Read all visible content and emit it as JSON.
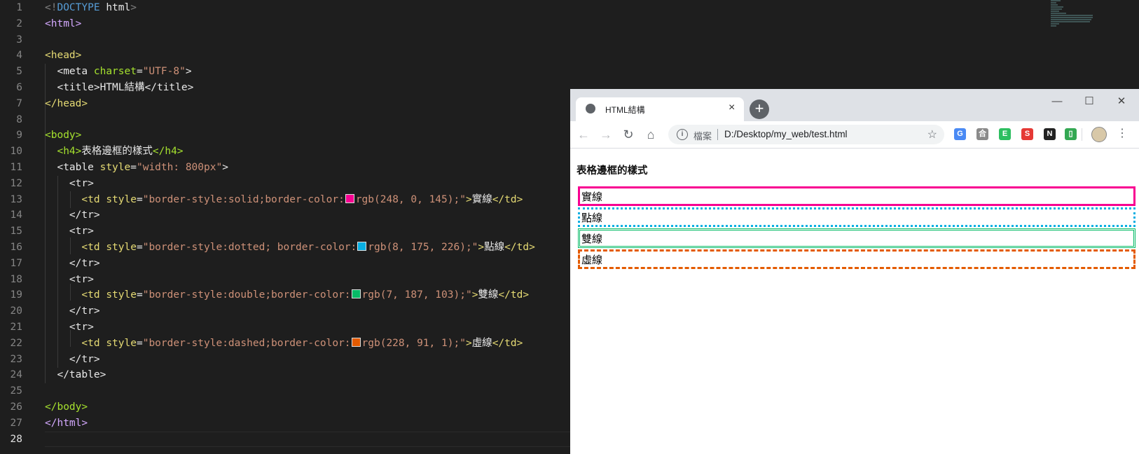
{
  "editor": {
    "line_numbers": [
      "1",
      "2",
      "3",
      "4",
      "5",
      "6",
      "7",
      "8",
      "9",
      "10",
      "11",
      "12",
      "13",
      "14",
      "15",
      "16",
      "17",
      "18",
      "19",
      "20",
      "21",
      "22",
      "23",
      "24",
      "25",
      "26",
      "27",
      "28"
    ],
    "doctype_open": "<!",
    "doctype_kw": "DOCTYPE",
    "doctype_html": "html",
    "doctype_close": ">",
    "html_open": "<html>",
    "head_open": "<head>",
    "meta_tag": "<meta",
    "meta_attr": "charset",
    "meta_eq": "=",
    "meta_val": "\"UTF-8\"",
    "meta_close": ">",
    "title_open": "<title>",
    "title_text": "HTML結構",
    "title_close": "</title>",
    "head_close": "</head>",
    "body_open": "<body>",
    "h4_open": "<h4>",
    "h4_text": "表格邊框的樣式",
    "h4_close": "</h4>",
    "table_open": "<table",
    "table_attr": "style",
    "table_eq": "=",
    "table_val": "\"width: 800px\"",
    "table_gt": ">",
    "tr_open": "<tr>",
    "tr_close": "</tr>",
    "td_open": "<td",
    "td_attr": "style",
    "td_eq": "=",
    "td_close": "</td>",
    "rows": [
      {
        "pre": "\"border-style:solid;border-color:",
        "color": "rgb(248, 0, 145)",
        "post": ";\"",
        "text": "實線",
        "swatch": "#f80091"
      },
      {
        "pre": "\"border-style:dotted; border-color:",
        "color": "rgb(8, 175, 226)",
        "post": ";\"",
        "text": "點線",
        "swatch": "#08afe2"
      },
      {
        "pre": "\"border-style:double;border-color:",
        "color": "rgb(7, 187, 103)",
        "post": ";\"",
        "text": "雙線",
        "swatch": "#07bb67"
      },
      {
        "pre": "\"border-style:dashed;border-color:",
        "color": "rgb(228, 91, 1)",
        "post": ";\"",
        "text": "虛線",
        "swatch": "#e45b01"
      }
    ],
    "gt": ">",
    "table_close": "</table>",
    "body_close": "</body>",
    "html_close": "</html>"
  },
  "browser": {
    "tab_title": "HTML結構",
    "tab_close": "×",
    "new_tab": "+",
    "win_min": "—",
    "win_max": "☐",
    "win_close": "✕",
    "back": "←",
    "forward": "→",
    "reload": "↻",
    "home": "⌂",
    "info": "i",
    "security_label": "檔案",
    "url": "D:/Desktop/my_web/test.html",
    "star": "☆",
    "extensions": [
      {
        "name": "translate-extension-icon",
        "glyph": "G",
        "color": "#4a8af4"
      },
      {
        "name": "extension-icon-2",
        "glyph": "合",
        "color": "#8a8a8a"
      },
      {
        "name": "evernote-extension-icon",
        "glyph": "E",
        "color": "#2dbe60"
      },
      {
        "name": "s-extension-icon",
        "glyph": "S",
        "color": "#e53935"
      },
      {
        "name": "notion-extension-icon",
        "glyph": "N",
        "color": "#222222"
      },
      {
        "name": "clipboard-extension-icon",
        "glyph": "▯",
        "color": "#34a853"
      }
    ],
    "menu": "⋮",
    "page": {
      "heading": "表格邊框的樣式",
      "cells": [
        "實線",
        "點線",
        "雙線",
        "虛線"
      ]
    }
  }
}
